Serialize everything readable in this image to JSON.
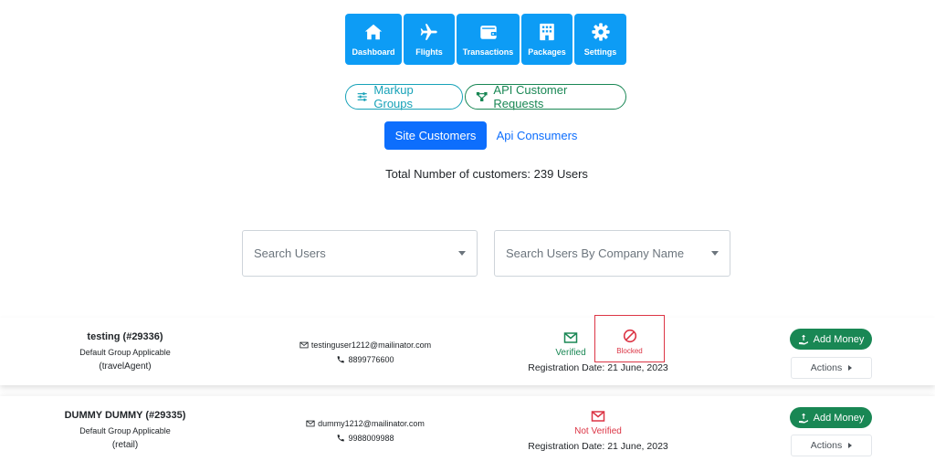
{
  "nav": [
    {
      "label": "Dashboard",
      "icon": "home-icon"
    },
    {
      "label": "Flights",
      "icon": "plane-icon"
    },
    {
      "label": "Transactions",
      "icon": "wallet-icon"
    },
    {
      "label": "Packages",
      "icon": "building-icon"
    },
    {
      "label": "Settings",
      "icon": "gear-icon"
    }
  ],
  "pills": {
    "markup_groups": "Markup Groups",
    "api_customer_requests": "API Customer Requests"
  },
  "tabs": {
    "site_customers": "Site Customers",
    "api_consumers": "Api Consumers"
  },
  "total_text": "Total Number of customers: 239 Users",
  "search": {
    "users_placeholder": "Search Users",
    "company_placeholder": "Search Users By Company Name"
  },
  "customers": [
    {
      "name": "testing (#29336)",
      "group": "Default Group Applicable",
      "type": "(travelAgent)",
      "email": "testinguser1212@mailinator.com",
      "phone": "8899776600",
      "verification": "Verified",
      "blocked_label": "Blocked",
      "registration": "Registration Date: 21 June, 2023"
    },
    {
      "name": "DUMMY DUMMY (#29335)",
      "group": "Default Group Applicable",
      "type": "(retail)",
      "email": "dummy1212@mailinator.com",
      "phone": "9988009988",
      "verification": "Not Verified",
      "registration": "Registration Date: 21 June, 2023"
    }
  ],
  "row_actions": {
    "add_money": "Add Money",
    "actions": "Actions"
  },
  "colors": {
    "nav_blue": "#0d9cf5",
    "primary": "#0d6efd",
    "success": "#198754",
    "info": "#17a2b8",
    "danger": "#dc3545"
  }
}
